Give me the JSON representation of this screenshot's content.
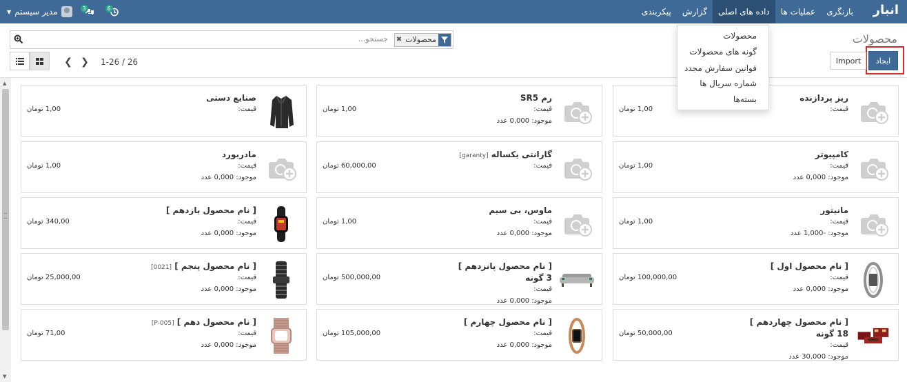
{
  "navbar": {
    "brand": "انبار",
    "menu": [
      "بازنگری",
      "عملیات ها",
      "داده های اصلی",
      "گزارش",
      "پیکربندی"
    ],
    "active_menu": "داده های اصلی",
    "user": "مدیر سیستم",
    "messages_badge": "3",
    "activity_badge": "6"
  },
  "dropdown": {
    "items": [
      "محصولات",
      "گونه های محصولات",
      "قوانین سفارش مجدد",
      "شماره سریال ها",
      "بسته‌ها"
    ]
  },
  "control_panel": {
    "title": "محصولات",
    "search_placeholder": "جستجو...",
    "facet_label": "محصولات",
    "create_label": "ایجاد",
    "import_label": "Import",
    "pager": "1-26 / 26"
  },
  "cards": [
    {
      "name": "ریز پردازنده",
      "code": "",
      "name2": "",
      "price_label": "قیمت:",
      "price": "1,00 تومان",
      "stock": "",
      "image": "camera-placeholder"
    },
    {
      "name": "رم SR5",
      "code": "",
      "name2": "",
      "price_label": "قیمت:",
      "price": "1,00 تومان",
      "stock": "موجود: 0,000 عدد",
      "image": "camera-placeholder"
    },
    {
      "name": "صنایع دستی",
      "code": "",
      "name2": "",
      "price_label": "قیمت:",
      "price": "1,00 تومان",
      "stock": "",
      "image": "jacket"
    },
    {
      "name": "کامپیوتر",
      "code": "",
      "name2": "",
      "price_label": "قیمت:",
      "price": "1,00 تومان",
      "stock": "موجود: 0,000 عدد",
      "image": "camera-placeholder"
    },
    {
      "name": "گارانتی یکساله",
      "code": "[garanty]",
      "name2": "",
      "price_label": "قیمت:",
      "price": "60,000,00 تومان",
      "stock": "",
      "image": "camera-placeholder"
    },
    {
      "name": "مادربورد",
      "code": "",
      "name2": "",
      "price_label": "قیمت:",
      "price": "1,00 تومان",
      "stock": "موجود: 0,000 عدد",
      "image": "camera-placeholder"
    },
    {
      "name": "مانیتور",
      "code": "",
      "name2": "",
      "price_label": "قیمت:",
      "price": "1,00 تومان",
      "stock": "موجود: -1,000 عدد",
      "image": "camera-placeholder"
    },
    {
      "name": "ماوس، بی سیم",
      "code": "",
      "name2": "",
      "price_label": "قیمت:",
      "price": "1,00 تومان",
      "stock": "موجود: 0,000 عدد",
      "image": "camera-placeholder"
    },
    {
      "name": "[ نام محصول یازدهم ]",
      "code": "",
      "name2": "",
      "price_label": "قیمت:",
      "price": "340,00 تومان",
      "stock": "موجود: 0,000 عدد",
      "image": "smart-band"
    },
    {
      "name": "[ نام محصول اول ]",
      "code": "",
      "name2": "",
      "price_label": "قیمت:",
      "price": "100,000,00 تومان",
      "stock": "موجود: 0,000 عدد",
      "image": "silver-band"
    },
    {
      "name": "[ نام محصول پانزدهم ]",
      "code": "",
      "name2": "3 گونه",
      "price_label": "قیمت:",
      "price": "500,000,00 تومان",
      "stock": "موجود: 0,000 عدد",
      "image": "sofa"
    },
    {
      "name": "[ نام محصول پنجم ]",
      "code": "[0021]",
      "name2": "",
      "price_label": "قیمت:",
      "price": "25,000,00 تومان",
      "stock": "موجود: 0,000 عدد",
      "image": "metal-band"
    },
    {
      "name": "[ نام محصول چهاردهم ]",
      "code": "",
      "name2": "18 گونه",
      "price_label": "قیمت:",
      "price": "50,000,00 تومان",
      "stock": "موجود: 30,000 عدد",
      "image": "sofa-set"
    },
    {
      "name": "[ نام محصول چهارم ]",
      "code": "",
      "name2": "",
      "price_label": "قیمت:",
      "price": "105,000,00 تومان",
      "stock": "موجود: 0,000 عدد",
      "image": "rose-band"
    },
    {
      "name": "[ نام محصول دهم ]",
      "code": "[P-005]",
      "name2": "",
      "price_label": "قیمت:",
      "price": "71,00 تومان",
      "stock": "موجود: 0,000 عدد",
      "image": "mesh-band"
    }
  ]
}
